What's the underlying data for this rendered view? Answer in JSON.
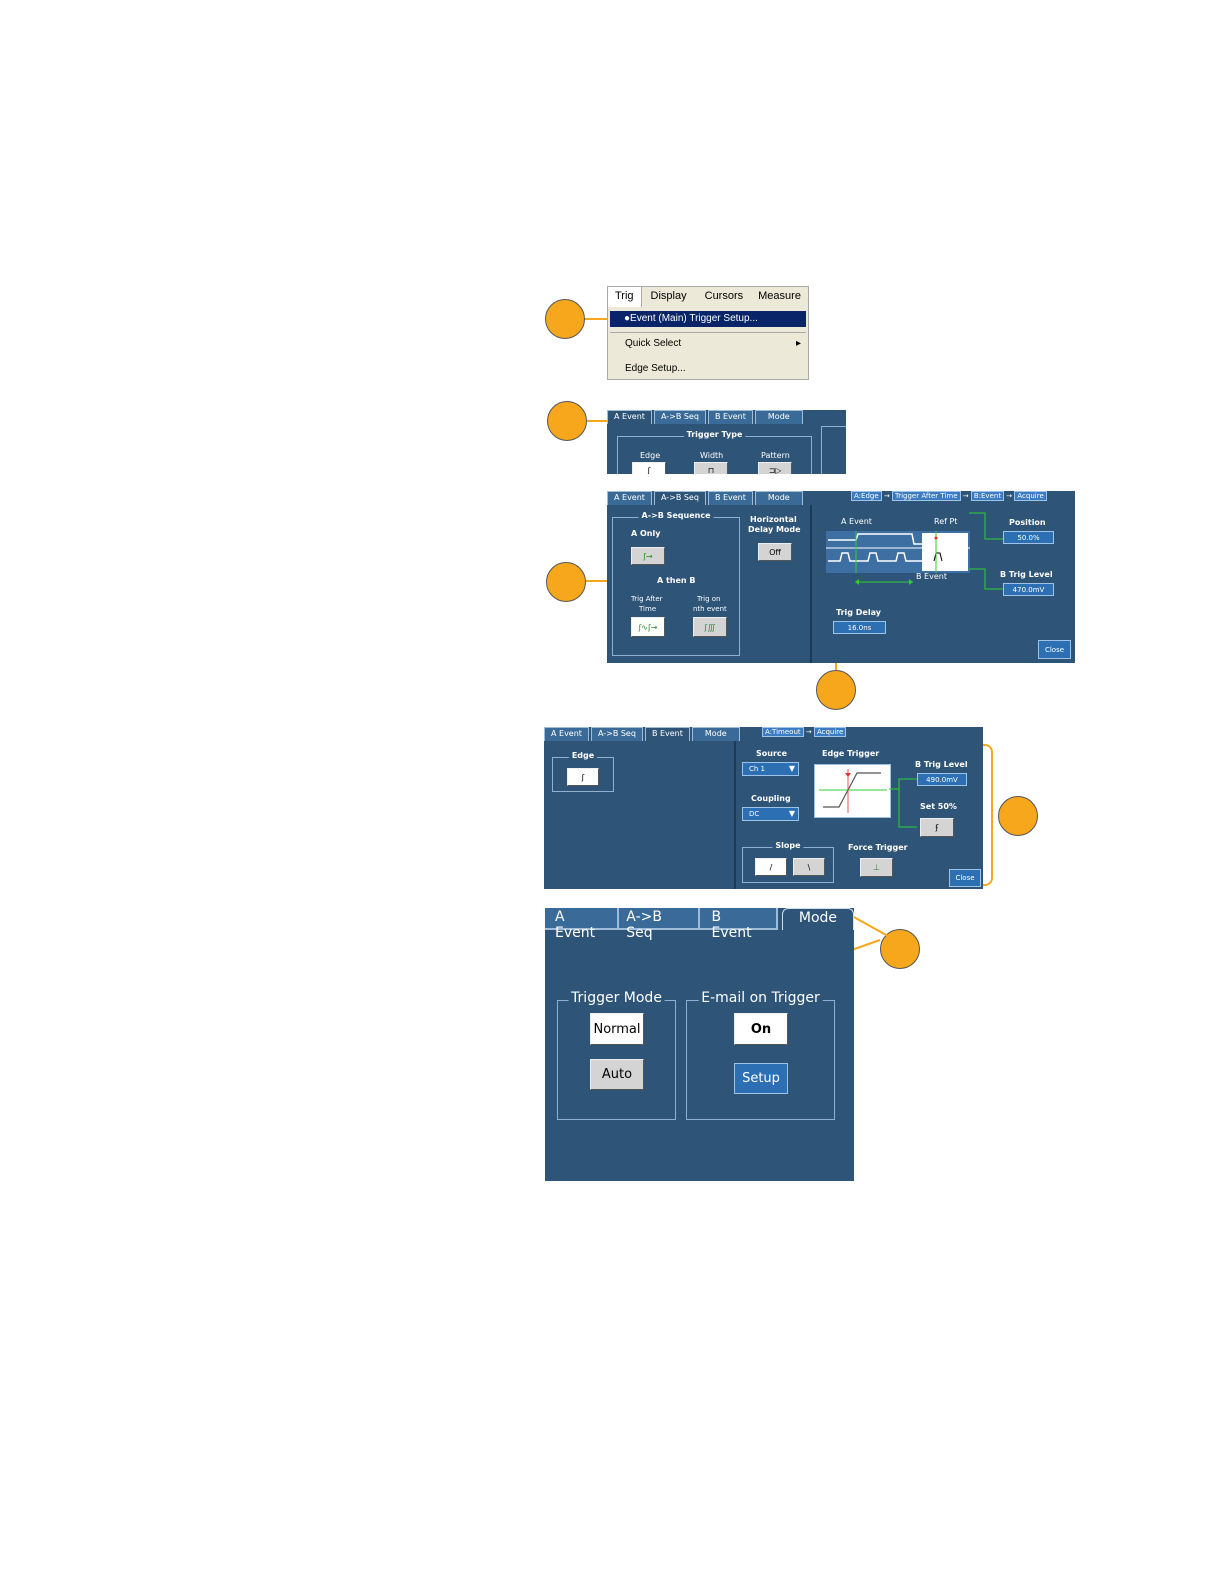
{
  "menu": {
    "bar_items": [
      "Trig",
      "Display",
      "Cursors",
      "Measure"
    ],
    "selected_item": "Event (Main) Trigger Setup...",
    "quick_select": "Quick Select",
    "edge_setup": "Edge Setup..."
  },
  "tabs": {
    "a_event": "A Event",
    "ab_seq": "A->B Seq",
    "b_event": "B Event",
    "mode": "Mode"
  },
  "panel1": {
    "group_title": "Trigger Type",
    "edge": "Edge",
    "width": "Width",
    "pattern": "Pattern"
  },
  "panel2": {
    "breadcrumb": [
      "A:Edge",
      "Trigger After Time",
      "B:Event",
      "Acquire"
    ],
    "seq_title": "A->B Sequence",
    "a_only": "A Only",
    "a_then_b": "A then B",
    "trig_after_time": [
      "Trig After",
      "Time"
    ],
    "trig_on_nth": [
      "Trig on",
      "nth event"
    ],
    "horizontal_delay": [
      "Horizontal",
      "Delay Mode"
    ],
    "delay_value": "Off",
    "a_event_label": "A Event",
    "ref_pt": "Ref Pt",
    "b_event_label": "B Event",
    "position_label": "Position",
    "position_value": "50.0%",
    "b_trig_level_label": "B Trig Level",
    "b_trig_level_value": "470.0mV",
    "trig_delay_label": "Trig Delay",
    "trig_delay_value": "16.0ns",
    "close": "Close"
  },
  "panel3": {
    "breadcrumb": [
      "A:Timeout",
      "Acquire"
    ],
    "edge_group": "Edge",
    "source_label": "Source",
    "source_value": "Ch 1",
    "coupling_label": "Coupling",
    "coupling_value": "DC",
    "edge_trigger_label": "Edge Trigger",
    "b_trig_level_label": "B Trig Level",
    "b_trig_level_value": "490.0mV",
    "set50": "Set 50%",
    "slope_label": "Slope",
    "force_trigger": "Force Trigger",
    "close": "Close"
  },
  "panel4": {
    "trigger_mode_title": "Trigger Mode",
    "normal": "Normal",
    "auto": "Auto",
    "email_title": "E-mail on Trigger",
    "on": "On",
    "setup": "Setup"
  },
  "colors": {
    "panel": "#2e5478",
    "callout": "#f7a71c",
    "value_box": "#2c6fb3",
    "menu_highlight": "#0a246a"
  }
}
